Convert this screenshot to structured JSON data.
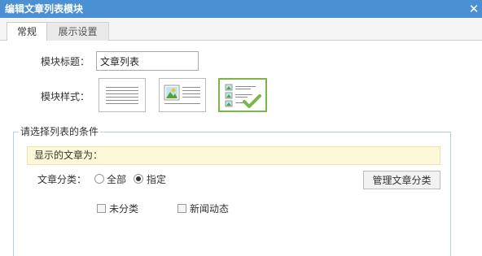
{
  "dialog": {
    "title": "编辑文章列表模块",
    "close_glyph": "✕"
  },
  "tabs": [
    {
      "label": "常规",
      "active": true
    },
    {
      "label": "展示设置",
      "active": false
    }
  ],
  "form": {
    "title_label": "模块标题：",
    "title_value": "文章列表",
    "style_label": "模块样式：",
    "style_options": [
      {
        "icon": "text-list-icon",
        "selected": false
      },
      {
        "icon": "image-text-icon",
        "selected": false
      },
      {
        "icon": "thumbnail-list-icon",
        "selected": true
      }
    ]
  },
  "conditions": {
    "legend": "请选择列表的条件",
    "notice": "显示的文章为：",
    "category_label": "文章分类：",
    "radio_all": "全部",
    "radio_specified": "指定",
    "selected_radio": "指定",
    "manage_button": "管理文章分类",
    "categories": [
      {
        "label": "未分类",
        "checked": false
      },
      {
        "label": "新闻动态",
        "checked": false
      }
    ]
  },
  "colors": {
    "titlebar": "#4a90d3",
    "selected_border": "#7ab648",
    "notice_bg": "#fdf8d7"
  }
}
